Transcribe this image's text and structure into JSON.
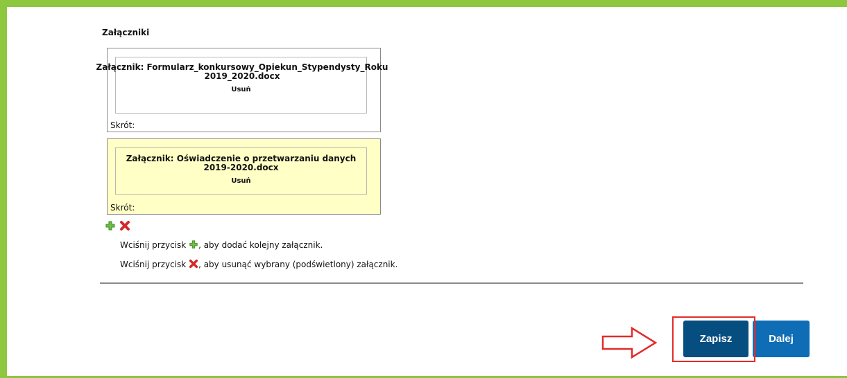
{
  "section": {
    "title": "Załączniki"
  },
  "attachments": [
    {
      "filename": "Załącznik: Formularz_konkursowy_Opiekun_Stypendysty_Roku 2019_2020.docx",
      "remove_label": "Usuń",
      "shortcut_label": "Skrót:",
      "highlighted": false
    },
    {
      "filename": "Załącznik: Oświadczenie o przetwarzaniu danych 2019-2020.docx",
      "remove_label": "Usuń",
      "shortcut_label": "Skrót:",
      "highlighted": true
    }
  ],
  "help": {
    "add_prefix": "Wciśnij przycisk",
    "add_suffix": ", aby dodać kolejny załącznik.",
    "remove_prefix": "Wciśnij przycisk",
    "remove_suffix": ", aby usunąć wybrany (podświetlony) załącznik."
  },
  "icons": {
    "add": "plus-icon",
    "remove": "x-icon",
    "annotation": "arrow-right-icon"
  },
  "buttons": {
    "save_label": "Zapisz",
    "next_label": "Dalej"
  },
  "colors": {
    "frame": "#8dc63f",
    "highlight": "#ffffc6",
    "button": "#0b5c95",
    "annotation": "#e32b2b",
    "add_icon": "#5aa83a",
    "remove_icon": "#d32a2a"
  }
}
